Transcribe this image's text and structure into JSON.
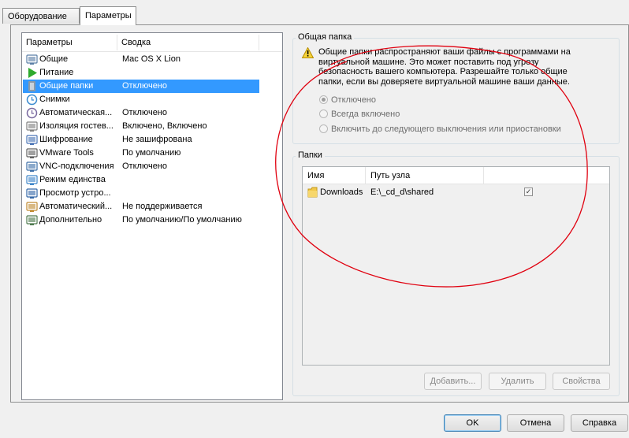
{
  "tabs": [
    {
      "label": "Оборудование"
    },
    {
      "label": "Параметры"
    }
  ],
  "settings_list": {
    "columns": {
      "name": "Параметры",
      "summary": "Сводка"
    },
    "items": [
      {
        "name": "Общие",
        "summary": "Mac OS X Lion",
        "icon": "general-icon"
      },
      {
        "name": "Питание",
        "summary": "",
        "icon": "power-play-icon"
      },
      {
        "name": "Общие папки",
        "summary": "Отключено",
        "icon": "shared-folders-icon"
      },
      {
        "name": "Снимки",
        "summary": "",
        "icon": "snapshots-icon"
      },
      {
        "name": "Автоматическая...",
        "summary": "Отключено",
        "icon": "autoprotect-icon"
      },
      {
        "name": "Изоляция гостев...",
        "summary": "Включено, Включено",
        "icon": "isolation-icon"
      },
      {
        "name": "Шифрование",
        "summary": "Не зашифрована",
        "icon": "encryption-icon"
      },
      {
        "name": "VMware Tools",
        "summary": "По умолчанию",
        "icon": "vmware-tools-icon"
      },
      {
        "name": "VNC-подключения",
        "summary": "Отключено",
        "icon": "vnc-icon"
      },
      {
        "name": "Режим единства",
        "summary": "",
        "icon": "unity-icon"
      },
      {
        "name": "Просмотр устро...",
        "summary": "",
        "icon": "device-view-icon"
      },
      {
        "name": "Автоматический...",
        "summary": "Не поддерживается",
        "icon": "autologin-icon"
      },
      {
        "name": "Дополнительно",
        "summary": "По умолчанию/По умолчанию",
        "icon": "advanced-icon"
      }
    ],
    "selected_index": 2
  },
  "shared_folders": {
    "title": "Общая папка",
    "warning_lines": [
      "Общие папки распространяют ваши файлы с программами на",
      "виртуальной машине. Это может поставить под угрозу",
      "безопасность вашего компьютера. Разрешайте только общие",
      "папки, если вы доверяете виртуальной машине ваши данные."
    ],
    "options": [
      {
        "label": "Отключено",
        "selected": true
      },
      {
        "label": "Всегда включено",
        "selected": false
      },
      {
        "label": "Включить до следующего выключения или приостановки",
        "selected": false
      }
    ]
  },
  "folders": {
    "title": "Папки",
    "columns": {
      "name": "Имя",
      "path": "Путь узла"
    },
    "rows": [
      {
        "name": "Downloads",
        "path": "E:\\_cd_d\\shared",
        "enabled": true
      }
    ],
    "buttons": {
      "add": "Добавить...",
      "remove": "Удалить",
      "properties": "Свойства"
    }
  },
  "dialog_buttons": {
    "ok": "OK",
    "cancel": "Отмена",
    "help": "Справка"
  },
  "colors": {
    "selection": "#3399ff",
    "annotation": "#e0000f"
  }
}
